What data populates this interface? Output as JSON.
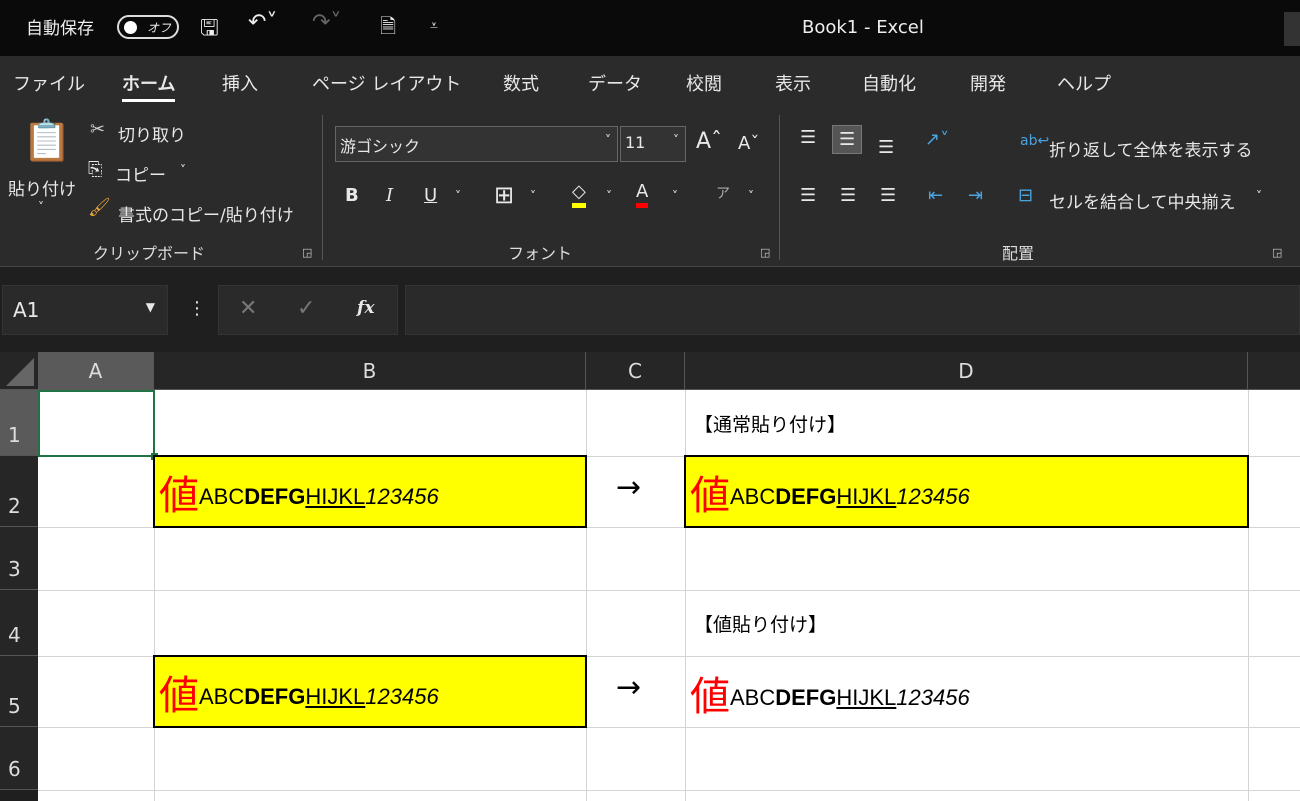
{
  "titlebar": {
    "autosave_label": "自動保存",
    "autosave_state": "オフ",
    "title": "Book1  -  Excel"
  },
  "tabs": [
    "ファイル",
    "ホーム",
    "挿入",
    "ページ レイアウト",
    "数式",
    "データ",
    "校閲",
    "表示",
    "自動化",
    "開発",
    "ヘルプ"
  ],
  "ribbon": {
    "clipboard": {
      "paste": "貼り付け",
      "cut": "切り取り",
      "copy": "コピー",
      "format_painter": "書式のコピー/貼り付け",
      "group": "クリップボード"
    },
    "font": {
      "name": "游ゴシック",
      "size": "11",
      "group": "フォント",
      "bold": "B",
      "italic": "I",
      "underline": "U",
      "font_color": "A"
    },
    "alignment": {
      "wrap": "折り返して全体を表示する",
      "merge": "セルを結合して中央揃え",
      "group": "配置"
    }
  },
  "formula_bar": {
    "name_box": "A1",
    "fx": "fx",
    "value": ""
  },
  "columns": [
    "A",
    "B",
    "C",
    "D"
  ],
  "rows": [
    "1",
    "2",
    "3",
    "4",
    "5",
    "6"
  ],
  "cells": {
    "D1": "【通常貼り付け】",
    "D4": "【値貼り付け】",
    "C2": "→",
    "C5": "→",
    "rich": {
      "kanji": "値",
      "normal": "ABC",
      "bold": "DEFG",
      "underline": "HIJKL",
      "italic": "123456"
    }
  },
  "colors": {
    "fill": "#ffff00",
    "kanji": "#ff0000",
    "selection": "#217346"
  }
}
